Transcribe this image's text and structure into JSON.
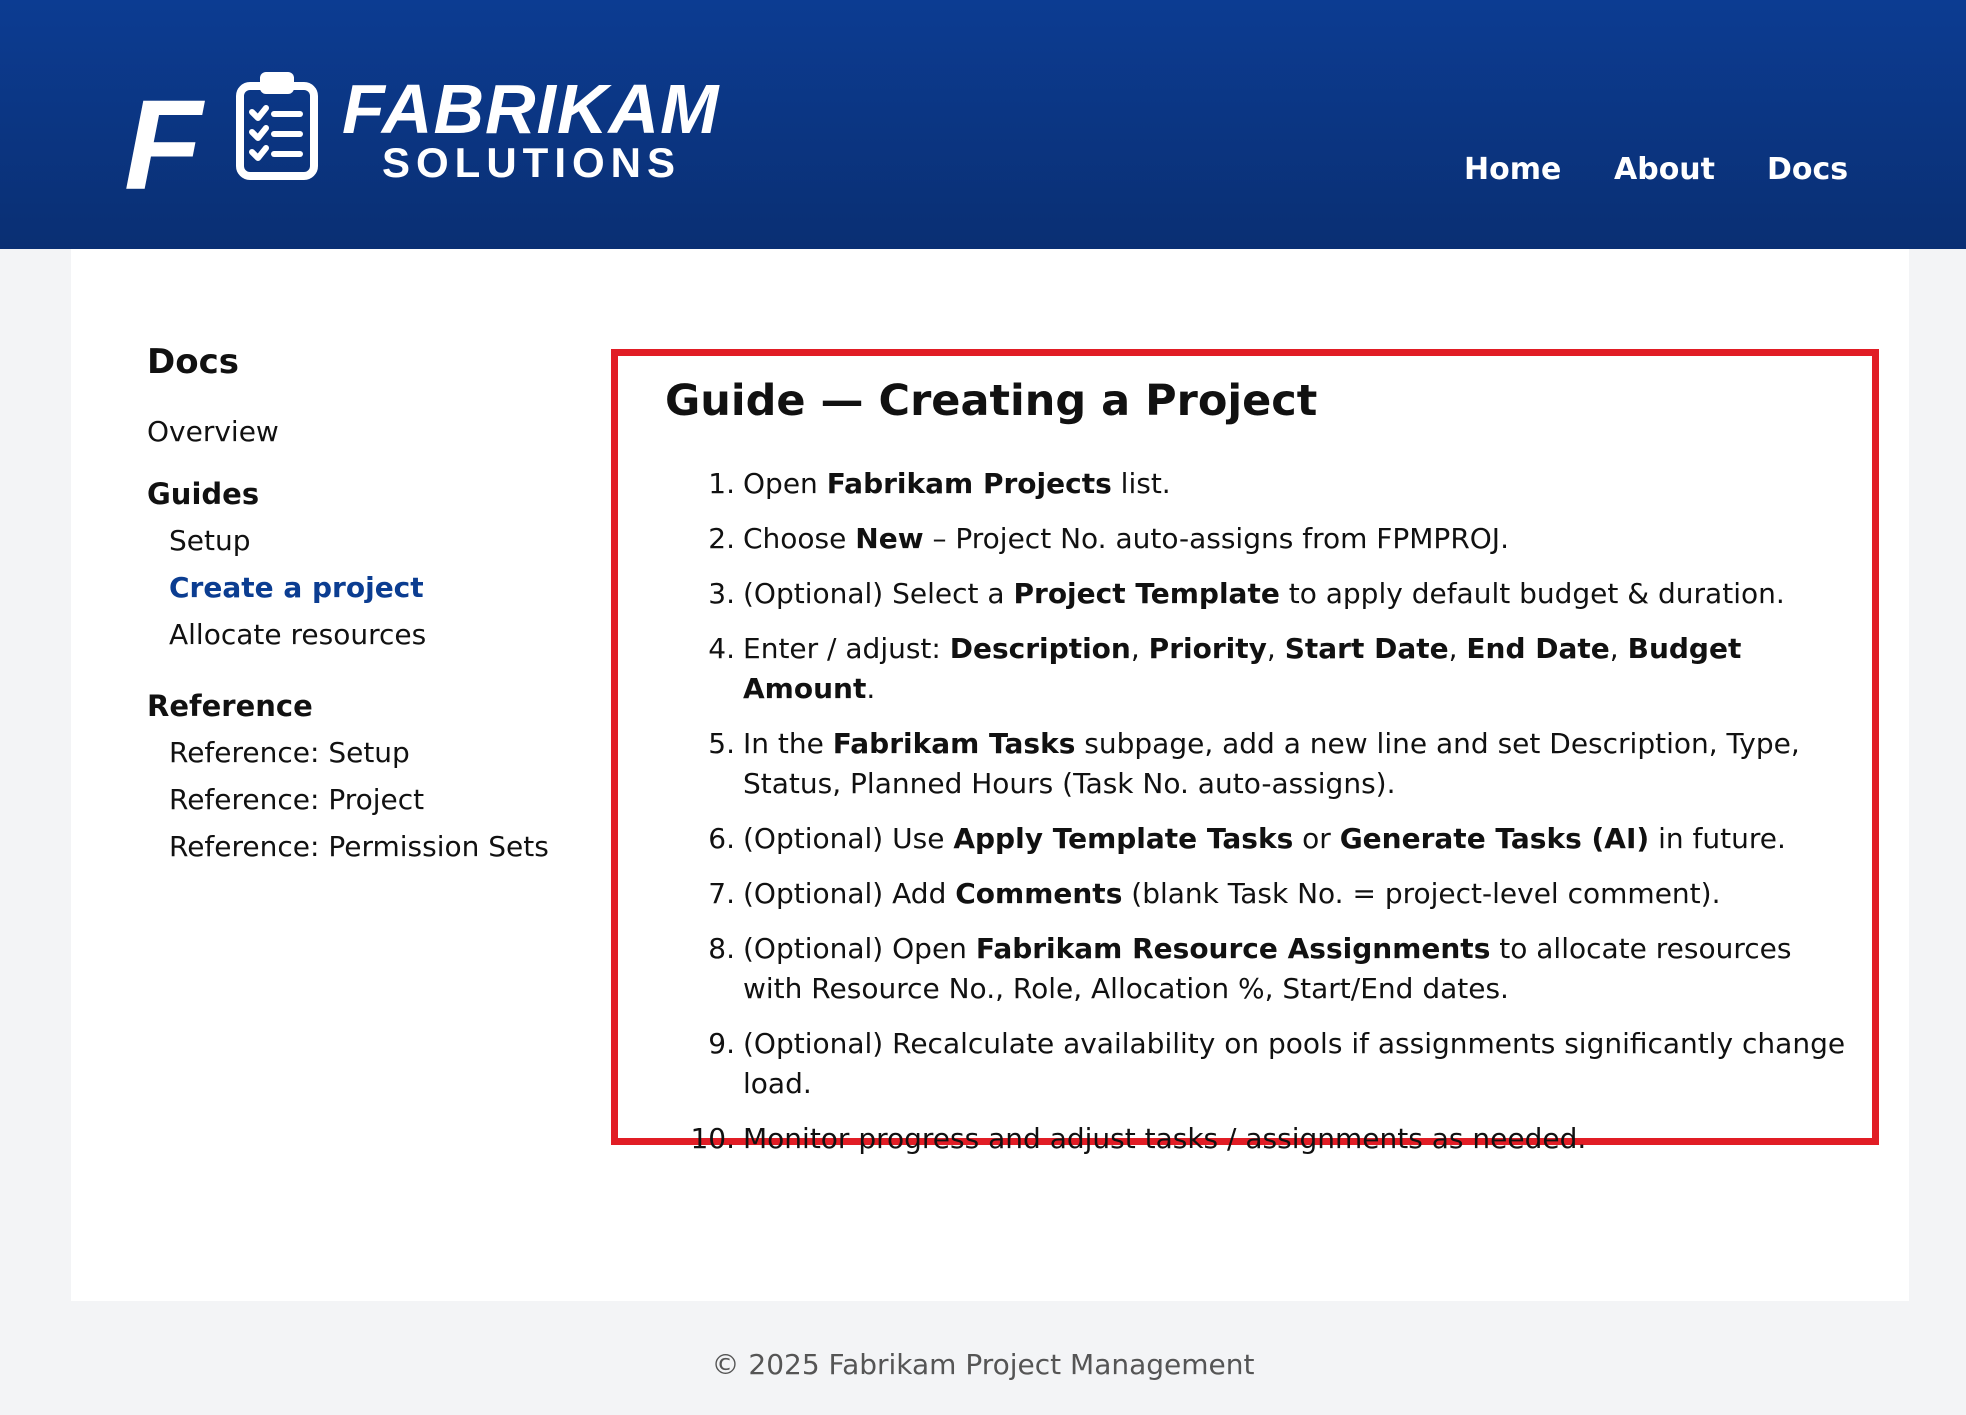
{
  "brand": {
    "logo_letter": "F",
    "word1": "FABRIKAM",
    "word2": "SOLUTIONS"
  },
  "nav": [
    {
      "label": "Home"
    },
    {
      "label": "About"
    },
    {
      "label": "Docs"
    }
  ],
  "sidebar": {
    "title": "Docs",
    "overview": "Overview",
    "groups": [
      {
        "label": "Guides",
        "items": [
          "Setup",
          "Create a project",
          "Allocate resources"
        ],
        "active": "Create a project"
      },
      {
        "label": "Reference",
        "items": [
          "Reference: Setup",
          "Reference: Project",
          "Reference: Permission Sets"
        ]
      }
    ]
  },
  "guide": {
    "title": "Guide — Creating a Project",
    "steps": [
      [
        [
          "t",
          "Open "
        ],
        [
          "b",
          "Fabrikam Projects"
        ],
        [
          "t",
          " list."
        ]
      ],
      [
        [
          "t",
          "Choose "
        ],
        [
          "b",
          "New"
        ],
        [
          "t",
          " – Project No. auto-assigns from FPMPROJ."
        ]
      ],
      [
        [
          "t",
          "(Optional) Select a "
        ],
        [
          "b",
          "Project Template"
        ],
        [
          "t",
          " to apply default budget & duration."
        ]
      ],
      [
        [
          "t",
          "Enter / adjust: "
        ],
        [
          "b",
          "Description"
        ],
        [
          "t",
          ", "
        ],
        [
          "b",
          "Priority"
        ],
        [
          "t",
          ", "
        ],
        [
          "b",
          "Start Date"
        ],
        [
          "t",
          ", "
        ],
        [
          "b",
          "End Date"
        ],
        [
          "t",
          ", "
        ],
        [
          "b",
          "Budget Amount"
        ],
        [
          "t",
          "."
        ]
      ],
      [
        [
          "t",
          "In the "
        ],
        [
          "b",
          "Fabrikam Tasks"
        ],
        [
          "t",
          " subpage, add a new line and set Description, Type, Status, Planned Hours (Task No. auto-assigns)."
        ]
      ],
      [
        [
          "t",
          "(Optional) Use "
        ],
        [
          "b",
          "Apply Template Tasks"
        ],
        [
          "t",
          " or "
        ],
        [
          "b",
          "Generate Tasks (AI)"
        ],
        [
          "t",
          " in future."
        ]
      ],
      [
        [
          "t",
          "(Optional) Add "
        ],
        [
          "b",
          "Comments"
        ],
        [
          "t",
          " (blank Task No. = project-level comment)."
        ]
      ],
      [
        [
          "t",
          "(Optional) Open "
        ],
        [
          "b",
          "Fabrikam Resource Assignments"
        ],
        [
          "t",
          " to allocate resources with Resource No., Role, Allocation %, Start/End dates."
        ]
      ],
      [
        [
          "t",
          "(Optional) Recalculate availability on pools if assignments significantly change load."
        ]
      ],
      [
        [
          "t",
          "Monitor progress and adjust tasks / assignments as needed."
        ]
      ]
    ]
  },
  "footer": {
    "text": "© 2025 Fabrikam Project Management"
  },
  "colors": {
    "header": "#0c3c92",
    "highlight_border": "#e11d25",
    "active_link": "#0b3d91"
  }
}
